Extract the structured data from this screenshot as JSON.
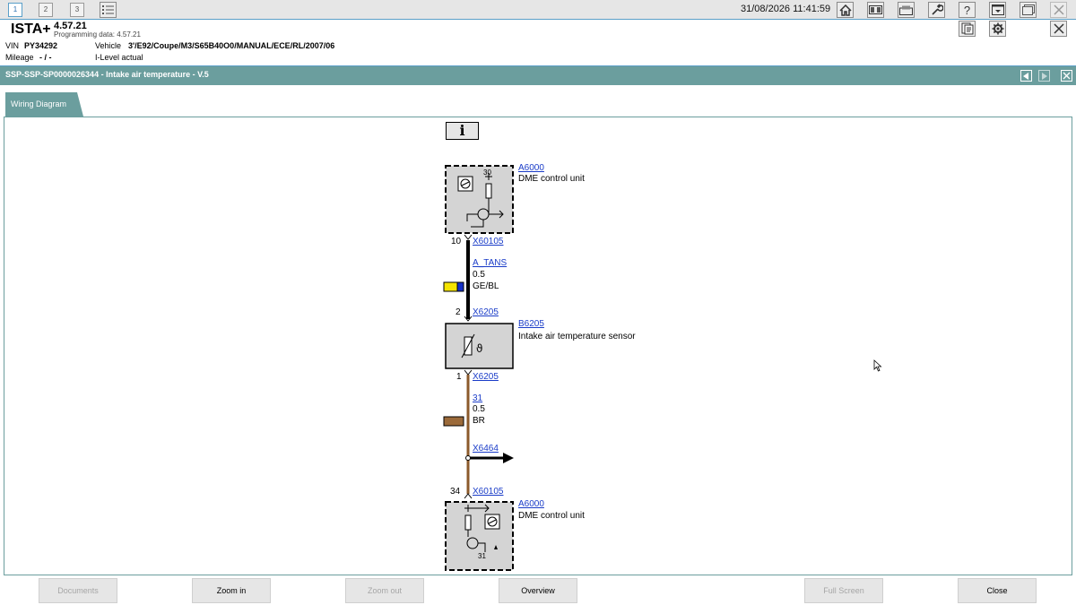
{
  "topbar": {
    "tabs": [
      "1",
      "2",
      "3"
    ],
    "datetime": "31/08/2026 11:41:59"
  },
  "header": {
    "app_name": "ISTA+",
    "version": "4.57.21",
    "programming_data": "Programming data:  4.57.21",
    "vin_label": "VIN",
    "vin_value": "PY34292",
    "vehicle_label": "Vehicle",
    "vehicle_value": "3'/E92/Coupe/M3/S65B40O0/MANUAL/ECE/RL/2007/06",
    "mileage_label": "Mileage",
    "mileage_value": "- / -",
    "ilevel_label": "I-Level actual"
  },
  "titlebar": {
    "title": "SSP-SSP-SP0000026344 - Intake air temperature - V.5"
  },
  "tabs": {
    "wiring": "Wiring Diagram"
  },
  "diagram": {
    "info_symbol": "i",
    "unit_top": {
      "id": "A6000",
      "name": "DME control unit",
      "terminal": "30"
    },
    "conn_top": {
      "pin": "10",
      "id": "X60105"
    },
    "wire_top": {
      "signal": "A_TANS",
      "gauge": "0.5",
      "color_code": "GE/BL"
    },
    "conn_sensor_in": {
      "pin": "2",
      "id": "X6205"
    },
    "sensor": {
      "id": "B6205",
      "name": "Intake air temperature sensor",
      "symbol": "ϑ"
    },
    "conn_sensor_out": {
      "pin": "1",
      "id": "X6205"
    },
    "wire_bottom": {
      "signal": "31",
      "gauge": "0.5",
      "color_code": "BR"
    },
    "splice": {
      "id": "X6464"
    },
    "conn_bottom": {
      "pin": "34",
      "id": "X60105"
    },
    "unit_bottom": {
      "id": "A6000",
      "name": "DME control unit",
      "terminal": "31"
    }
  },
  "buttons": {
    "documents": "Documents",
    "zoom_in": "Zoom in",
    "zoom_out": "Zoom out",
    "overview": "Overview",
    "full_screen": "Full Screen",
    "close": "Close"
  },
  "colors": {
    "accent": "#6b9e9e",
    "link": "#1a3cc8",
    "wire_black": "#000000",
    "wire_brown": "#8b5a2b",
    "swatch_yellow": "#f5e400",
    "swatch_blue": "#1530c8",
    "swatch_brown": "#9b6a3a"
  }
}
